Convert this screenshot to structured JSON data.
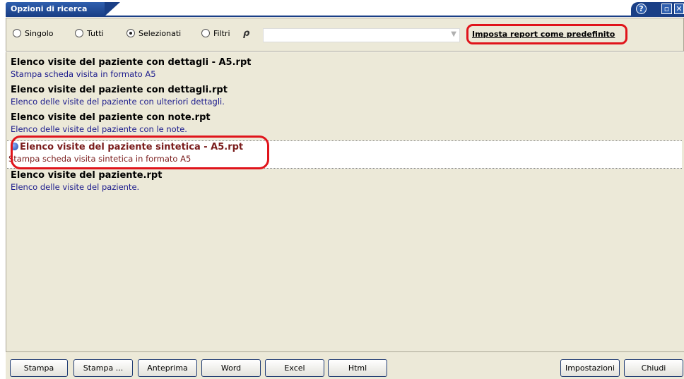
{
  "window": {
    "title": "Opzioni di ricerca",
    "help_icon": "?",
    "restore_icon": "restore-icon",
    "close_icon": "close-icon"
  },
  "toolbar": {
    "radio_options": [
      {
        "label": "Singolo",
        "selected": false
      },
      {
        "label": "Tutti",
        "selected": false
      },
      {
        "label": "Selezionati",
        "selected": true
      },
      {
        "label": "Filtri",
        "selected": false
      }
    ],
    "filter_icon": "ρ",
    "combo_value": "",
    "set_default_label": "Imposta report come predefinito"
  },
  "reports": [
    {
      "name": "Elenco visite del paziente con dettagli - A5.rpt",
      "description": "Stampa scheda visita in formato A5"
    },
    {
      "name": "Elenco visite del paziente con dettagli.rpt",
      "description": "Elenco delle visite del paziente con ulteriori dettagli."
    },
    {
      "name": "Elenco visite del paziente con note.rpt",
      "description": "Elenco delle visite del paziente con le note."
    },
    {
      "name": "Elenco visite del paziente sintetica - A5.rpt",
      "description": "Stampa scheda visita sintetica in formato A5",
      "selected": true
    },
    {
      "name": "Elenco visite del paziente.rpt",
      "description": "Elenco delle visite del paziente."
    }
  ],
  "buttons": {
    "stampa": "Stampa",
    "stampa_dialog": "Stampa ...",
    "anteprima": "Anteprima",
    "word": "Word",
    "excel": "Excel",
    "html": "Html",
    "impostazioni": "Impostazioni",
    "chiudi": "Chiudi"
  },
  "colors": {
    "title_bar": "#1a3f86",
    "panel_background": "#ece9d8",
    "description_text": "#1a1a8c",
    "selected_text": "#7a1c1c",
    "annotation_red": "#e0141b"
  }
}
